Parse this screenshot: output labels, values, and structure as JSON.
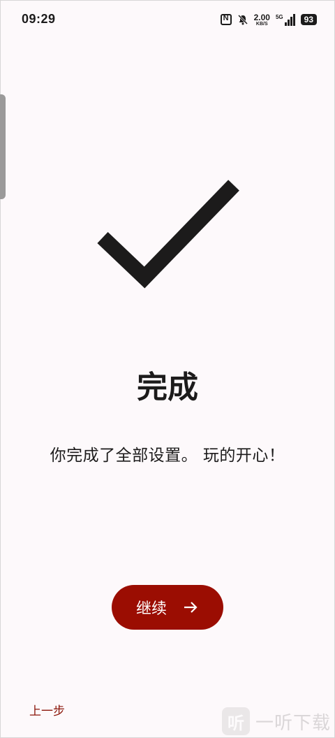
{
  "status_bar": {
    "time": "09:29",
    "speed_value": "2.00",
    "speed_unit": "KB/S",
    "network": "5G",
    "battery": "93"
  },
  "main": {
    "title": "完成",
    "description": "你完成了全部设置。 玩的开心！",
    "icon": "checkmark-icon"
  },
  "buttons": {
    "continue_label": "继续",
    "previous_label": "上一步"
  },
  "watermark": {
    "logo": "听",
    "text": "一听下载"
  },
  "colors": {
    "accent": "#9b0d02",
    "link": "#8a1408",
    "background": "#fdf9fb"
  }
}
